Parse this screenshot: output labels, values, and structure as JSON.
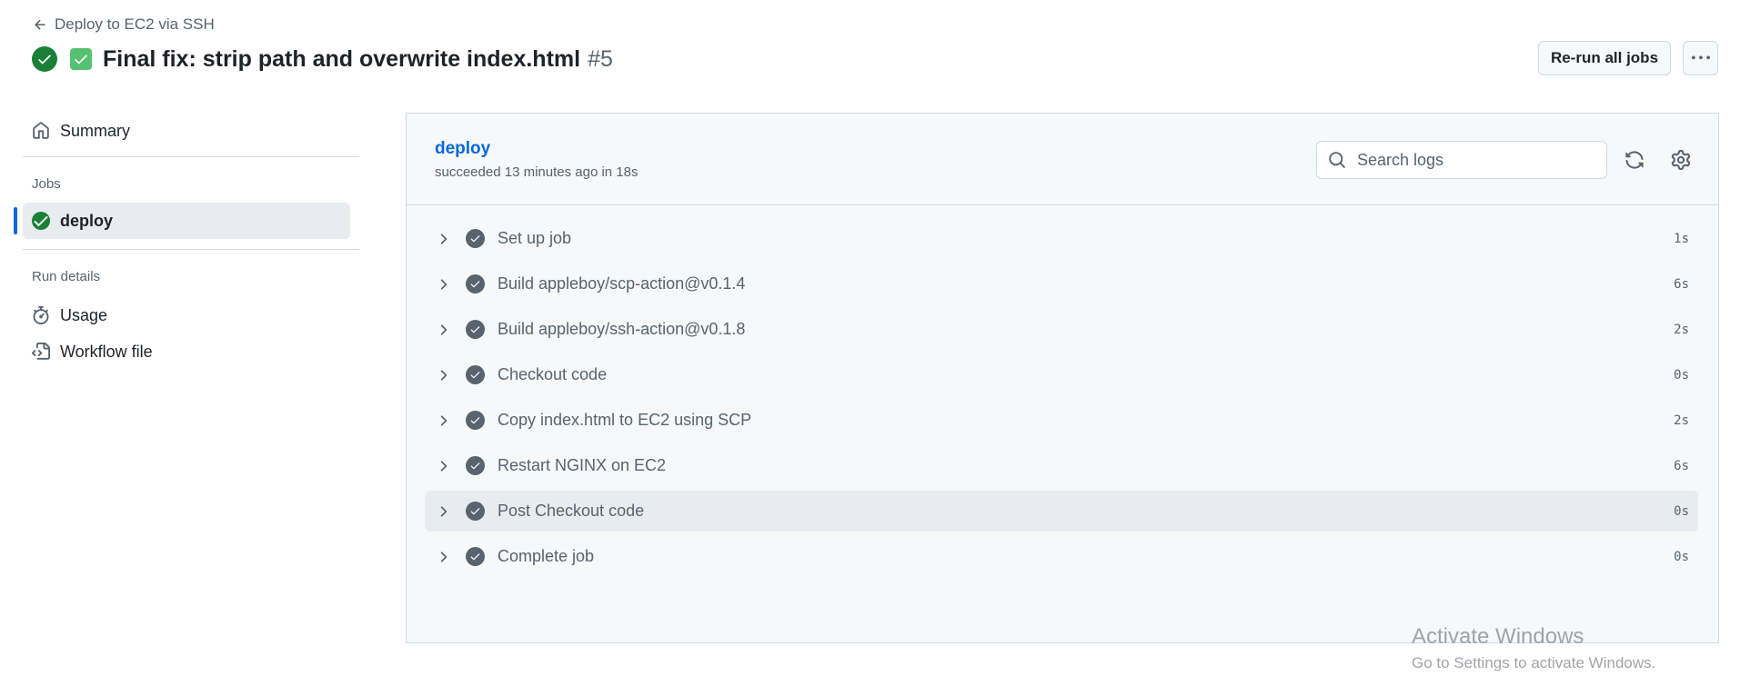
{
  "header": {
    "back_link": "Deploy to EC2 via SSH",
    "title": "Final fix: strip path and overwrite index.html",
    "run_number": "#5",
    "rerun_label": "Re-run all jobs"
  },
  "sidebar": {
    "summary_label": "Summary",
    "jobs_section": "Jobs",
    "jobs": [
      {
        "label": "deploy",
        "status": "success"
      }
    ],
    "run_details_section": "Run details",
    "run_details": [
      {
        "label": "Usage",
        "icon": "stopwatch-icon"
      },
      {
        "label": "Workflow file",
        "icon": "file-code-icon"
      }
    ]
  },
  "job": {
    "name": "deploy",
    "meta": "succeeded 13 minutes ago in 18s",
    "search_placeholder": "Search logs",
    "steps": [
      {
        "name": "Set up job",
        "duration": "1s"
      },
      {
        "name": "Build appleboy/scp-action@v0.1.4",
        "duration": "6s"
      },
      {
        "name": "Build appleboy/ssh-action@v0.1.8",
        "duration": "2s"
      },
      {
        "name": "Checkout code",
        "duration": "0s"
      },
      {
        "name": "Copy index.html to EC2 using SCP",
        "duration": "2s"
      },
      {
        "name": "Restart NGINX on EC2",
        "duration": "6s"
      },
      {
        "name": "Post Checkout code",
        "duration": "0s"
      },
      {
        "name": "Complete job",
        "duration": "0s"
      }
    ]
  },
  "watermark": {
    "title": "Activate Windows",
    "subtitle": "Go to Settings to activate Windows."
  },
  "colors": {
    "success": "#1a7f37",
    "link": "#0969da",
    "muted": "#59636e",
    "panel_bg": "#f6f8fa",
    "border": "#d1d9e0"
  }
}
